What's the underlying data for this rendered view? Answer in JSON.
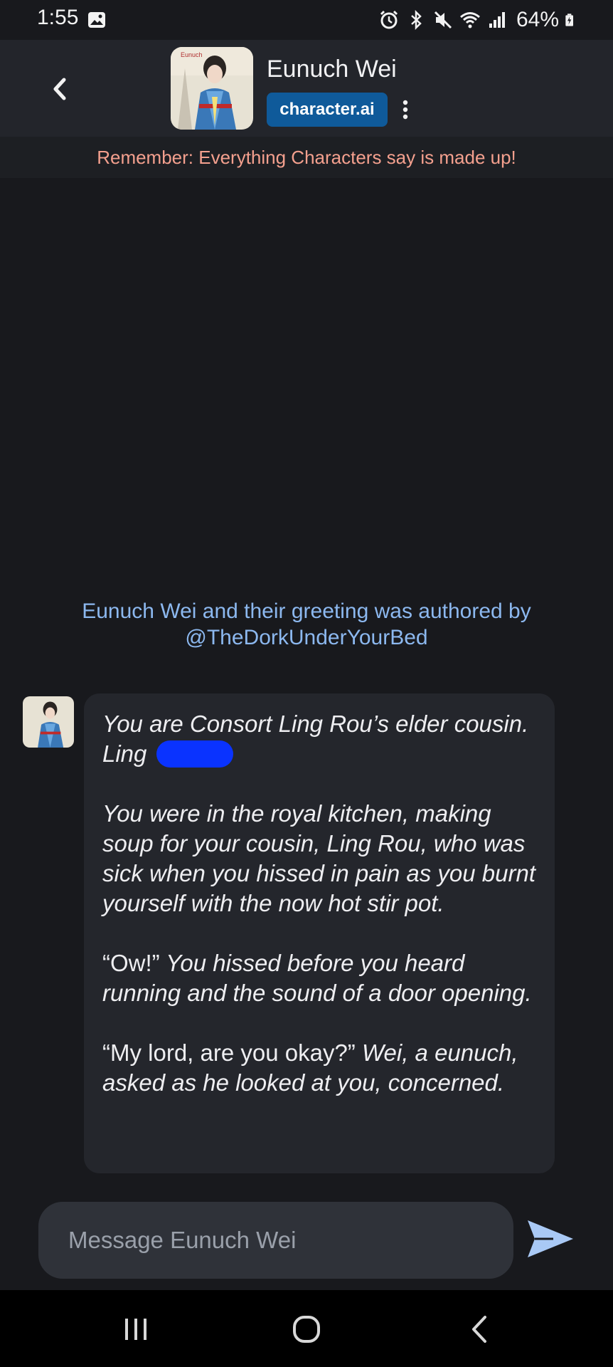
{
  "status_bar": {
    "time": "1:55",
    "battery": "64%",
    "icons": [
      "gallery-icon",
      "alarm-icon",
      "bluetooth-icon",
      "mute-icon",
      "wifi-icon",
      "signal-icon",
      "battery-icon"
    ]
  },
  "header": {
    "character_name": "Eunuch Wei",
    "badge": "character.ai",
    "avatar_caption": "Eunuch"
  },
  "disclaimer": "Remember: Everything Characters say is made up!",
  "author_note": {
    "line1": "Eunuch Wei and their greeting was authored by",
    "line2": "@TheDorkUnderYourBed"
  },
  "message": {
    "p1": "You are Consort Ling Rou’s elder cousin. Ling ",
    "p2": "You were in the royal kitchen, making soup for your cousin, Ling Rou, who was sick when you hissed in pain as you burnt yourself with the now hot stir pot.",
    "p3_quote": "“Ow!”",
    "p3_rest": " You hissed before you heard running and the sound of a door opening.",
    "p4_quote": "“My lord, are you okay?”",
    "p4_rest": " Wei, a eunuch, asked as he looked at you, concerned."
  },
  "composer": {
    "placeholder": "Message Eunuch Wei"
  },
  "colors": {
    "accent": "#0f5a9a",
    "disclaimer": "#f4a08e",
    "author_note": "#8cb8ef",
    "send": "#a9c9f5"
  }
}
